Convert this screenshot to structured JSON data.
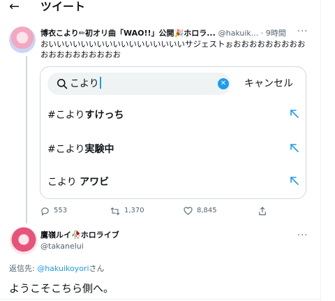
{
  "header": {
    "back_icon": "arrow-left-icon",
    "title": "ツイート"
  },
  "tweet": {
    "author_name": "博衣こより",
    "author_name_rest": "初オリ曲「WAO!!」公開",
    "author_name_tail": "ホロラ...",
    "handle_time": "@hakuik... · 9時間",
    "text": "おいいいいいいいいいいいいいいいいいサジェストぉおおおおおおおおおおおおおおおおおおお",
    "search": {
      "query": "こより",
      "cancel_label": "キャンセル"
    },
    "suggestions": [
      {
        "prefix": "#こより",
        "bold": "すけっち"
      },
      {
        "prefix": "#こより",
        "bold": "実験中"
      },
      {
        "prefix": "こより ",
        "bold": "アワビ"
      }
    ],
    "actions": {
      "replies": "553",
      "retweets": "1,370",
      "likes": "8,845"
    }
  },
  "reply": {
    "author_name": "鷹嶺ルイ",
    "author_name_rest": "ホロライブ",
    "handle": "@takanelui",
    "reply_to_prefix": "返信先: ",
    "reply_to_handle": "@hakuikoyori",
    "reply_to_suffix": "さん",
    "text": "ようこそこちら側へ。"
  },
  "colors": {
    "accent": "#1d9bf0",
    "text": "#0f1419",
    "muted": "#536471",
    "border": "#cfd9de"
  }
}
